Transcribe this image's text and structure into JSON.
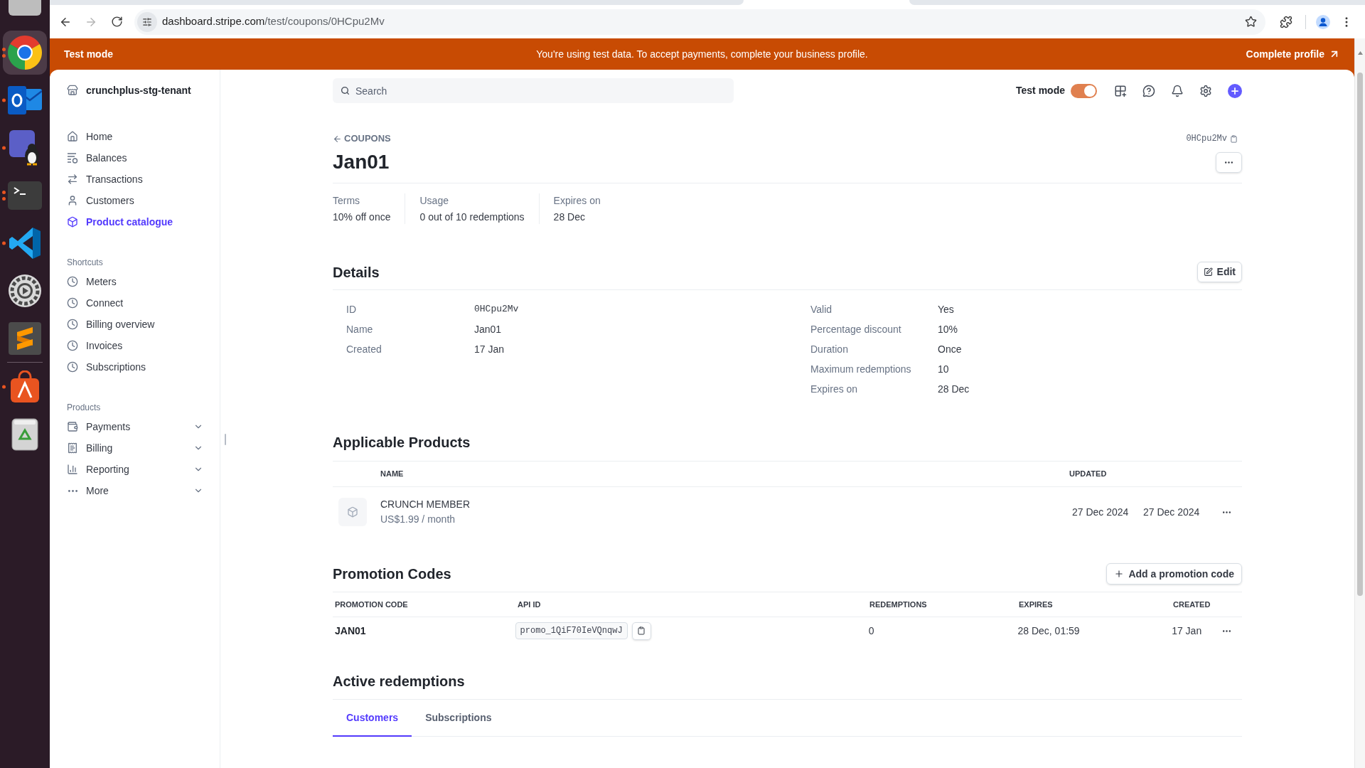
{
  "dock": [
    {
      "kind": "files",
      "running": false,
      "several": false,
      "selected": false
    },
    {
      "kind": "browser",
      "running": true,
      "several": true,
      "selected": true
    },
    {
      "kind": "mail",
      "running": true,
      "several": false,
      "selected": false
    },
    {
      "kind": "chat",
      "running": true,
      "several": false,
      "selected": false
    },
    {
      "kind": "terminal",
      "running": true,
      "several": true,
      "selected": false
    },
    {
      "kind": "code-editor",
      "running": true,
      "several": false,
      "selected": false
    },
    {
      "kind": "settings",
      "running": false,
      "several": false,
      "selected": false
    },
    {
      "kind": "text-editor",
      "running": false,
      "several": false,
      "selected": false
    },
    {
      "kind": "store",
      "running": true,
      "several": false,
      "selected": false
    },
    {
      "kind": "trash",
      "running": false,
      "several": false,
      "selected": false
    }
  ],
  "browser": {
    "back": {
      "disabled": false
    },
    "forward": {
      "disabled": true
    },
    "url_host": "dashboard.stripe.com",
    "url_path": "/test/coupons/0HCpu2Mv"
  },
  "banner": {
    "mode": "Test mode",
    "message": "You're using test data. To accept payments, complete your business profile.",
    "action": "Complete profile"
  },
  "sidebar": {
    "account": "crunchplus-stg-tenant",
    "items": [
      {
        "label": "Home",
        "selected": false
      },
      {
        "label": "Balances",
        "selected": false
      },
      {
        "label": "Transactions",
        "selected": false
      },
      {
        "label": "Customers",
        "selected": false
      },
      {
        "label": "Product catalogue",
        "selected": true
      }
    ],
    "shortcuts": {
      "title": "Shortcuts",
      "items": [
        {
          "label": "Meters",
          "selected": false
        },
        {
          "label": "Connect",
          "selected": false
        },
        {
          "label": "Billing overview",
          "selected": false
        },
        {
          "label": "Invoices",
          "selected": false
        },
        {
          "label": "Subscriptions",
          "selected": false
        }
      ]
    },
    "products": {
      "title": "Products",
      "items": [
        {
          "label": "Payments",
          "selected": false,
          "expanded": false
        },
        {
          "label": "Billing",
          "selected": false,
          "expanded": false
        },
        {
          "label": "Reporting",
          "selected": false,
          "expanded": false
        },
        {
          "label": "More",
          "selected": false,
          "expanded": false
        }
      ]
    }
  },
  "topbar": {
    "search": {
      "placeholder": "Search"
    },
    "test_mode": {
      "label": "Test mode",
      "on": true
    }
  },
  "coupon": {
    "breadcrumb": "COUPONS",
    "title": "Jan01",
    "id": "0HCpu2Mv",
    "stats": [
      {
        "label": "Terms",
        "value": "10% off once"
      },
      {
        "label": "Usage",
        "value": "0 out of 10 redemptions"
      },
      {
        "label": "Expires on",
        "value": "28 Dec"
      }
    ]
  },
  "details": {
    "title": "Details",
    "edit": "Edit",
    "left": [
      {
        "label": "ID",
        "value": "0HCpu2Mv",
        "kind": "code"
      },
      {
        "label": "Name",
        "value": "Jan01",
        "kind": "text"
      },
      {
        "label": "Created",
        "value": "17 Jan",
        "kind": "text"
      }
    ],
    "right": [
      {
        "label": "Valid",
        "value": "Yes",
        "kind": "text"
      },
      {
        "label": "Percentage discount",
        "value": "10%",
        "kind": "text"
      },
      {
        "label": "Duration",
        "value": "Once",
        "kind": "text"
      },
      {
        "label": "Maximum redemptions",
        "value": "10",
        "kind": "text"
      },
      {
        "label": "Expires on",
        "value": "28 Dec",
        "kind": "text"
      }
    ]
  },
  "products": {
    "title": "Applicable Products",
    "columns": [
      "NAME",
      "UPDATED"
    ],
    "rows": [
      {
        "name": "CRUNCH MEMBER",
        "price": "US$1.99 / month",
        "updated": "27 Dec 2024",
        "column_4": "27 Dec 2024"
      }
    ]
  },
  "promotion_codes": {
    "title": "Promotion Codes",
    "add": "Add a promotion code",
    "columns": [
      "PROMOTION CODE",
      "API ID",
      "REDEMPTIONS",
      "EXPIRES",
      "CREATED"
    ],
    "rows": [
      {
        "code": "JAN01",
        "api_id": "promo_1QiF70IeVQnqwJ",
        "redemptions": "0",
        "expires": "28 Dec, 01:59",
        "created": "17 Jan"
      }
    ]
  },
  "redemptions": {
    "title": "Active redemptions",
    "tabs": [
      {
        "label": "Customers",
        "selected": true
      },
      {
        "label": "Subscriptions",
        "selected": false
      }
    ]
  }
}
